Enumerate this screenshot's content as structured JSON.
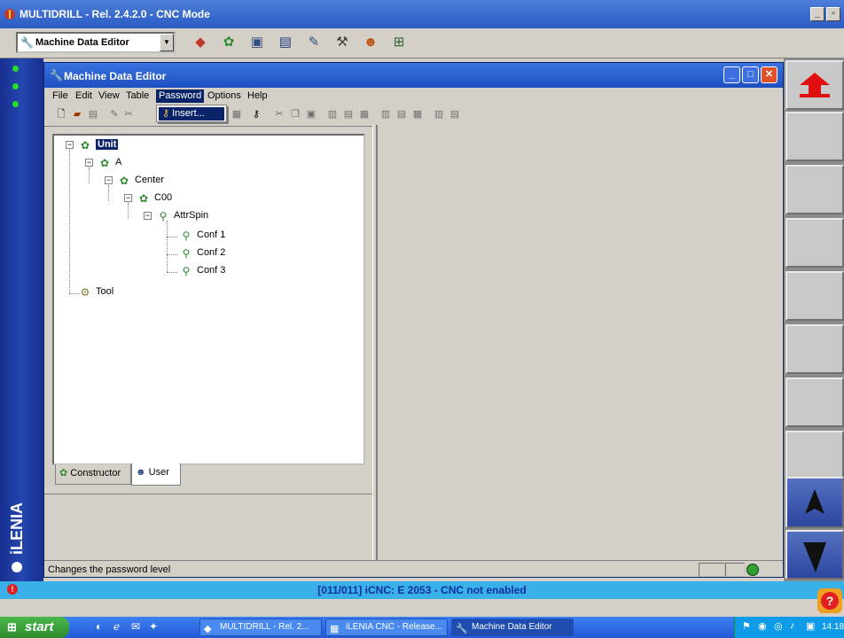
{
  "app": {
    "title": "MULTIDRILL  -  Rel. 2.4.2.0  -  CNC Mode"
  },
  "toolbar": {
    "combo_value": "Machine Data Editor"
  },
  "window": {
    "title": "Machine Data Editor"
  },
  "menu": {
    "items": [
      "File",
      "Edit",
      "View",
      "Table",
      "Password",
      "Options",
      "Help"
    ],
    "open_item": "Password"
  },
  "dropdown": {
    "items": [
      "Insert..."
    ]
  },
  "tree": {
    "nodes": [
      {
        "label": "Unit",
        "selected": true
      },
      {
        "label": "A"
      },
      {
        "label": "Center"
      },
      {
        "label": "C00"
      },
      {
        "label": "AttrSpin"
      },
      {
        "label": "Conf 1"
      },
      {
        "label": "Conf 2"
      },
      {
        "label": "Conf 3"
      },
      {
        "label": "Tool"
      }
    ]
  },
  "tabs": [
    "Constructor",
    "User"
  ],
  "status": {
    "text": "Changes the password level"
  },
  "cnc_status": {
    "text": "[011/011] iCNC: E  2053 - CNC not enabled"
  },
  "brand": {
    "logo_text": "iLENIA"
  },
  "taskbar": {
    "start_label": "start",
    "tasks": [
      "MULTIDRILL - Rel. 2...",
      "iLENIA CNC - Release...",
      "Machine Data Editor"
    ],
    "clock": "14.18"
  }
}
